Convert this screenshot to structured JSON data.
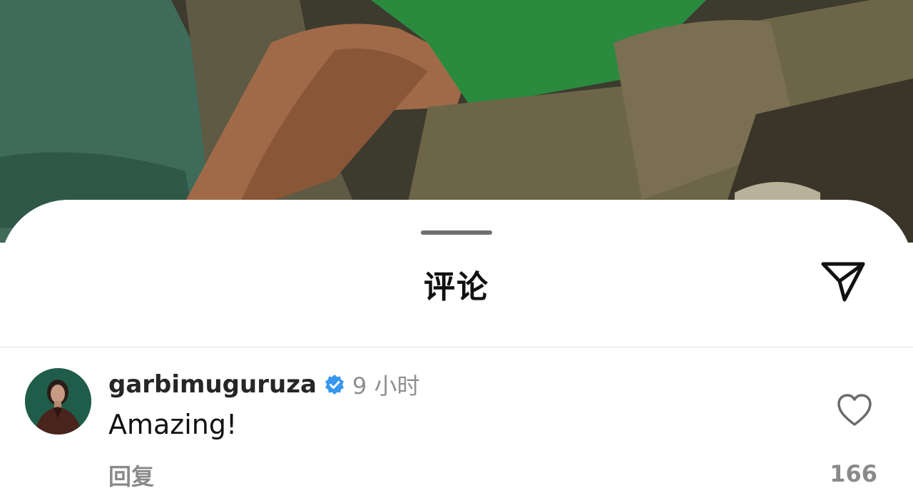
{
  "sheet": {
    "title": "评论"
  },
  "comment": {
    "username": "garbimuguruza",
    "verified": true,
    "time": "9 小时",
    "text": "Amazing!",
    "reply_label": "回复",
    "like_count": "166"
  },
  "icons": {
    "share": "send-icon",
    "verified": "verified-badge-icon",
    "like": "heart-icon"
  },
  "colors": {
    "verified_blue": "#3797f0",
    "secondary_text": "#8e8e8e",
    "primary_text": "#111111"
  }
}
